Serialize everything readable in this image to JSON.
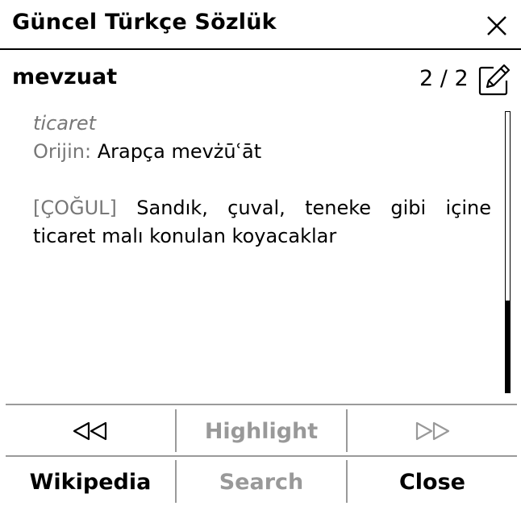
{
  "dialog": {
    "title": "Güncel Türkçe Sözlük"
  },
  "entry": {
    "word": "mevzuat",
    "pager": "2 / 2",
    "field": "ticaret",
    "origin_label": "Orijin:",
    "origin_value": "Arapça mevżūʿāt",
    "definition_tag": "[ÇOĞUL]",
    "definition_text": "Sandık, çuval, teneke gibi içine ticaret malı konulan koyacaklar"
  },
  "buttons": {
    "prev_icon": "double-triangle-left-icon",
    "highlight": "Highlight",
    "next_icon": "double-triangle-right-icon",
    "wikipedia": "Wikipedia",
    "search": "Search",
    "close": "Close"
  },
  "colors": {
    "text": "#000000",
    "muted": "#777777",
    "disabled": "#999999",
    "divider": "#9a9a9a"
  }
}
